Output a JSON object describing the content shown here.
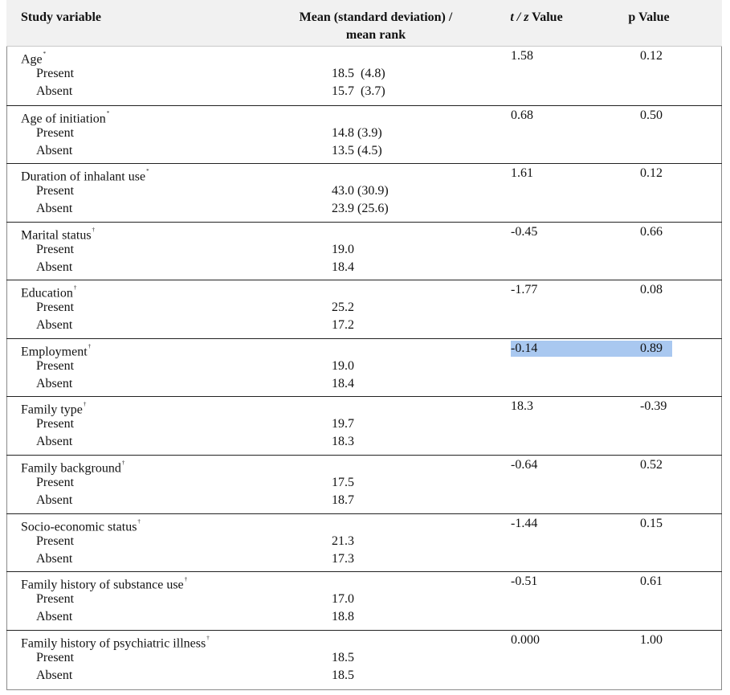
{
  "header": {
    "study_variable": "Study variable",
    "mean_line1": "Mean (standard deviation) /",
    "mean_line2": "mean rank",
    "tz_italic": "t / z",
    "tz_suffix": " Value",
    "p_value": "p Value"
  },
  "rows": [
    {
      "label": "Age",
      "mark": "*",
      "present_label": "Present",
      "absent_label": "Absent",
      "present": "18.5  (4.8)",
      "absent": "15.7  (3.7)",
      "tz": "1.58",
      "p": "0.12",
      "highlight": false
    },
    {
      "label": "Age of initiation",
      "mark": "*",
      "present_label": "Present",
      "absent_label": "Absent",
      "present": "14.8 (3.9)",
      "absent": "13.5 (4.5)",
      "tz": "0.68",
      "p": "0.50",
      "highlight": false
    },
    {
      "label": "Duration of inhalant use",
      "mark": "*",
      "present_label": "Present",
      "absent_label": "Absent",
      "present": "43.0 (30.9)",
      "absent": "23.9 (25.6)",
      "tz": "1.61",
      "p": "0.12",
      "highlight": false
    },
    {
      "label": "Marital status",
      "mark": "†",
      "present_label": "Present",
      "absent_label": "Absent",
      "present": "19.0",
      "absent": "18.4",
      "tz": "-0.45",
      "p": "0.66",
      "highlight": false
    },
    {
      "label": "Education",
      "mark": "†",
      "present_label": "Present",
      "absent_label": "Absent",
      "present": "25.2",
      "absent": "17.2",
      "tz": "-1.77",
      "p": "0.08",
      "highlight": false
    },
    {
      "label": "Employment",
      "mark": "†",
      "present_label": "Present",
      "absent_label": "Absent",
      "present": "19.0",
      "absent": "18.4",
      "tz": "-0.14",
      "p": "0.89",
      "highlight": true
    },
    {
      "label": "Family type",
      "mark": "†",
      "present_label": "Present",
      "absent_label": "Absent",
      "present": "19.7",
      "absent": "18.3",
      "tz": "18.3",
      "p": "-0.39",
      "highlight": false
    },
    {
      "label": "Family background",
      "mark": "†",
      "present_label": "Present",
      "absent_label": "Absent",
      "present": "17.5",
      "absent": "18.7",
      "tz": "-0.64",
      "p": "0.52",
      "highlight": false
    },
    {
      "label": "Socio-economic status",
      "mark": "†",
      "present_label": "Present",
      "absent_label": "Absent",
      "present": "21.3",
      "absent": "17.3",
      "tz": "-1.44",
      "p": "0.15",
      "highlight": false
    },
    {
      "label": "Family history of substance use",
      "mark": "†",
      "present_label": "Present",
      "absent_label": "Absent",
      "present": "17.0",
      "absent": "18.8",
      "tz": "-0.51",
      "p": "0.61",
      "highlight": false
    },
    {
      "label": "Family history of psychiatric illness",
      "mark": "†",
      "present_label": "Present",
      "absent_label": "Absent",
      "present": "18.5",
      "absent": "18.5",
      "tz": "0.000",
      "p": "1.00",
      "highlight": false
    }
  ],
  "colors": {
    "header_bg": "#f1f1f1",
    "highlight": "#a9c8f0",
    "rule": "#222222"
  }
}
